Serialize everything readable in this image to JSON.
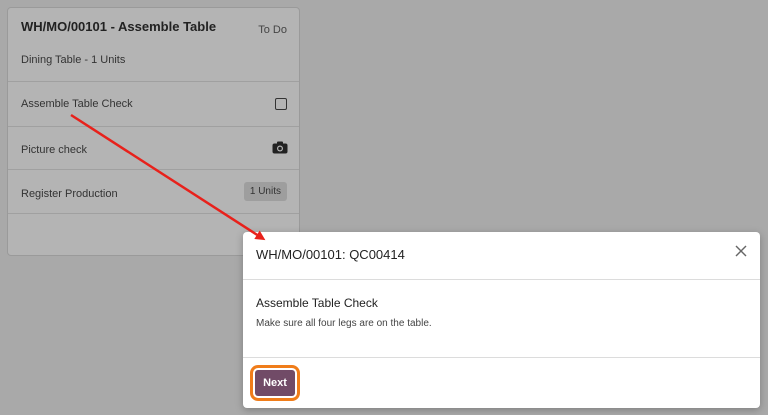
{
  "work_order": {
    "title": "WH/MO/00101 - Assemble Table",
    "status": "To Do",
    "product_line": "Dining Table - 1 Units",
    "steps": [
      {
        "label": "Assemble Table Check",
        "control": "checkbox"
      },
      {
        "label": "Picture check",
        "control": "camera-icon"
      },
      {
        "label": "Register Production",
        "badge": "1 Units"
      }
    ]
  },
  "dialog": {
    "title": "WH/MO/00101: QC00414",
    "check_title": "Assemble Table Check",
    "check_description": "Make sure all four legs are on the table.",
    "next_label": "Next"
  },
  "colors": {
    "annotation_arrow": "#e8211b",
    "highlight": "#f07d1a",
    "primary_button": "#714b67"
  }
}
